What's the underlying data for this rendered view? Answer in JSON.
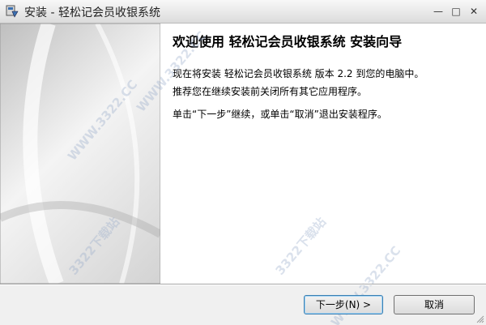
{
  "window": {
    "title": "安装 - 轻松记会员收银系统",
    "controls": {
      "minimize": "—",
      "maximize": "□",
      "close": "✕"
    }
  },
  "content": {
    "heading": "欢迎使用 轻松记会员收银系统 安装向导",
    "line1": "现在将安装 轻松记会员收银系统 版本 2.2 到您的电脑中。",
    "line2": "推荐您在继续安装前关闭所有其它应用程序。",
    "line3": "单击“下一步”继续，或单击“取消”退出安装程序。"
  },
  "buttons": {
    "next": "下一步(N) >",
    "cancel": "取消"
  },
  "watermark": {
    "text1": "WWW.3322.CC",
    "text2": "3322下载站"
  },
  "colors": {
    "accent": "#3c7fb1",
    "panel_background": "#ffffff",
    "window_background": "#f0f0f0"
  }
}
